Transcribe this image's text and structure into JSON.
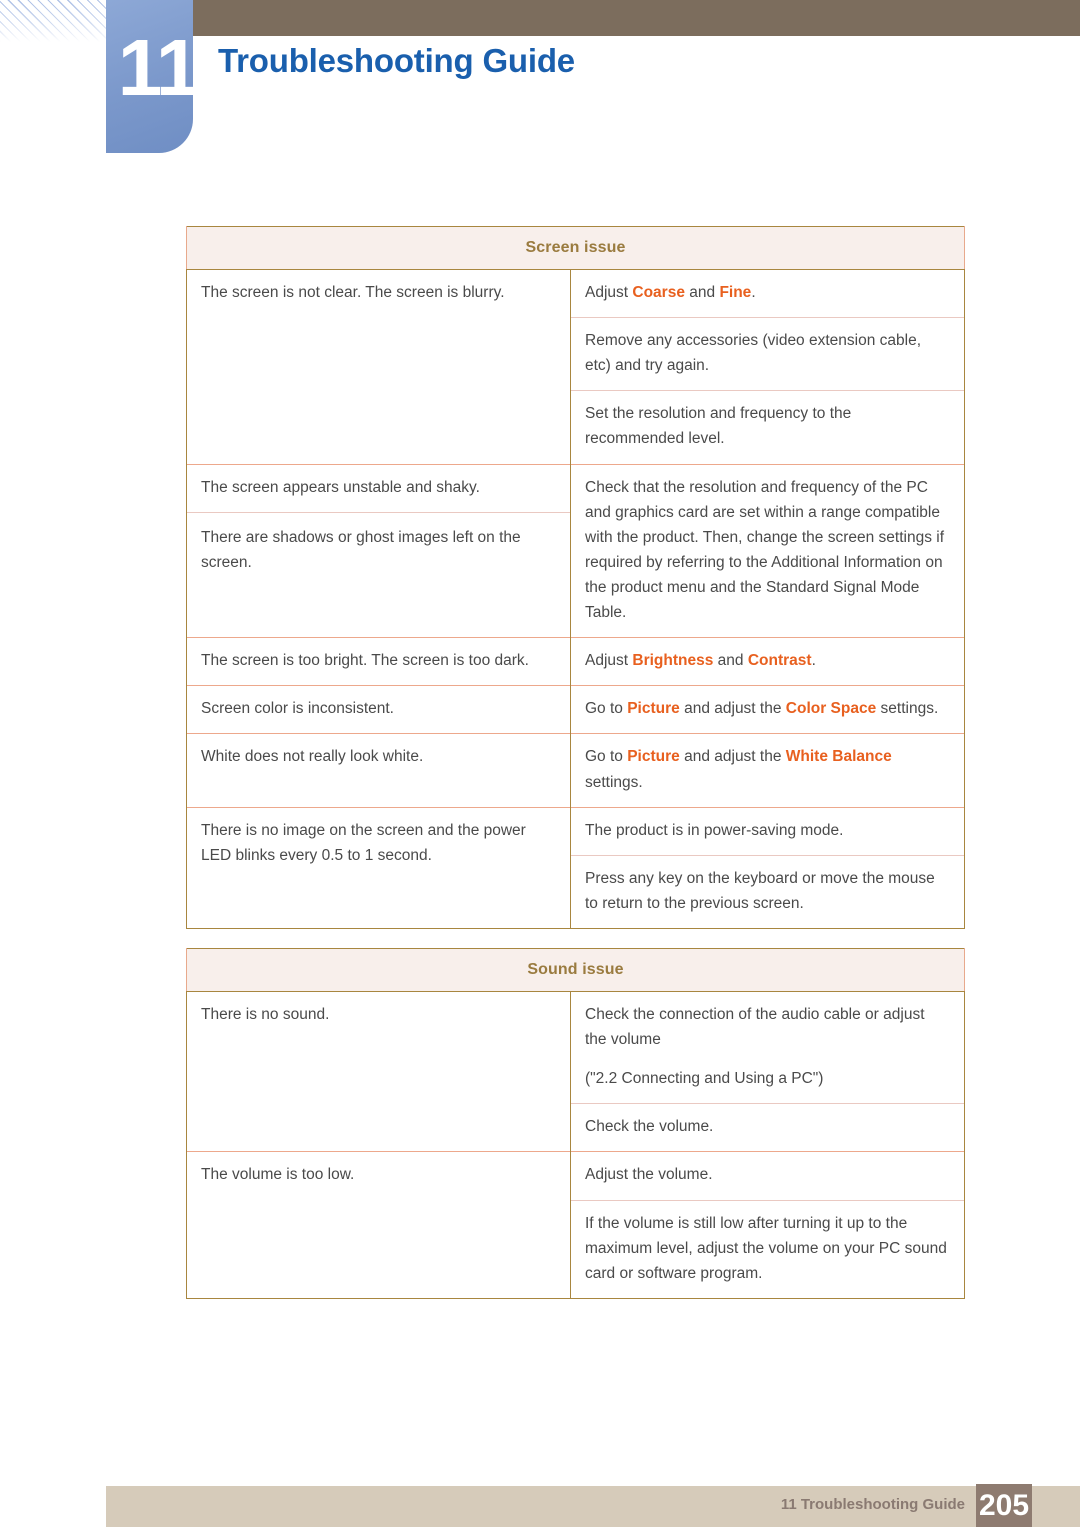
{
  "header": {
    "chapter_number": "11",
    "chapter_title": "Troubleshooting Guide",
    "accent_blue": "#1a5fad",
    "block_blue": "#7b98cb",
    "topbar_brown": "#7c6d5d"
  },
  "tables": [
    {
      "section_title": "Screen issue",
      "rows": [
        {
          "issue": "The screen is not clear. The screen is blurry.",
          "issue_rowspan": 3,
          "solutions": [
            {
              "parts": [
                {
                  "text": "Adjust ",
                  "hl": false
                },
                {
                  "text": "Coarse",
                  "hl": true
                },
                {
                  "text": " and ",
                  "hl": false
                },
                {
                  "text": "Fine",
                  "hl": true
                },
                {
                  "text": ".",
                  "hl": false
                }
              ]
            },
            {
              "parts": [
                {
                  "text": "Remove any accessories (video extension cable, etc) and try again.",
                  "hl": false
                }
              ]
            },
            {
              "parts": [
                {
                  "text": "Set the resolution and frequency to the recommended level.",
                  "hl": false
                }
              ]
            }
          ]
        },
        {
          "issue": "The screen appears unstable and shaky.",
          "issue2": "There are shadows or ghost images left on the screen.",
          "solutions": [
            {
              "parts": [
                {
                  "text": "Check that the resolution and frequency of the PC and graphics card are set within a range compatible with the product. Then, change the screen settings if required by referring to the Additional Information on the product menu and the Standard Signal Mode Table.",
                  "hl": false
                }
              ]
            }
          ]
        },
        {
          "issue": "The screen is too bright. The screen is too dark.",
          "solutions": [
            {
              "parts": [
                {
                  "text": "Adjust ",
                  "hl": false
                },
                {
                  "text": "Brightness",
                  "hl": true
                },
                {
                  "text": " and ",
                  "hl": false
                },
                {
                  "text": "Contrast",
                  "hl": true
                },
                {
                  "text": ".",
                  "hl": false
                }
              ]
            }
          ]
        },
        {
          "issue": "Screen color is inconsistent.",
          "solutions": [
            {
              "parts": [
                {
                  "text": "Go to ",
                  "hl": false
                },
                {
                  "text": "Picture",
                  "hl": true
                },
                {
                  "text": " and adjust the ",
                  "hl": false
                },
                {
                  "text": "Color Space",
                  "hl": true
                },
                {
                  "text": " settings.",
                  "hl": false
                }
              ]
            }
          ]
        },
        {
          "issue": "White does not really look white.",
          "solutions": [
            {
              "parts": [
                {
                  "text": "Go to ",
                  "hl": false
                },
                {
                  "text": "Picture",
                  "hl": true
                },
                {
                  "text": " and adjust the ",
                  "hl": false
                },
                {
                  "text": "White Balance",
                  "hl": true
                },
                {
                  "text": " settings.",
                  "hl": false
                }
              ]
            }
          ]
        },
        {
          "issue": "There is no image on the screen and the power LED blinks every 0.5 to 1 second.",
          "issue_rowspan": 2,
          "solutions": [
            {
              "parts": [
                {
                  "text": "The product is in power-saving mode.",
                  "hl": false
                }
              ]
            },
            {
              "parts": [
                {
                  "text": "Press any key on the keyboard or move the mouse to return to the previous screen.",
                  "hl": false
                }
              ]
            }
          ]
        }
      ]
    },
    {
      "section_title": "Sound issue",
      "rows": [
        {
          "issue": "There is no sound.",
          "issue_rowspan": 2,
          "solutions": [
            {
              "parts": [
                {
                  "text": "Check the connection of the audio cable or adjust the volume",
                  "hl": false
                }
              ],
              "extra": "(\"2.2 Connecting and Using a PC\")"
            },
            {
              "parts": [
                {
                  "text": "Check the volume.",
                  "hl": false
                }
              ]
            }
          ]
        },
        {
          "issue": "The volume is too low.",
          "issue_rowspan": 2,
          "solutions": [
            {
              "parts": [
                {
                  "text": "Adjust the volume.",
                  "hl": false
                }
              ]
            },
            {
              "parts": [
                {
                  "text": "If the volume is still low after turning it up to the maximum level, adjust the volume on your PC sound card or software program.",
                  "hl": false
                }
              ]
            }
          ]
        }
      ]
    }
  ],
  "footer": {
    "label": "11 Troubleshooting Guide",
    "page_number": "205",
    "bar_color": "#d6cbba",
    "page_box_color": "#8e7b70"
  }
}
